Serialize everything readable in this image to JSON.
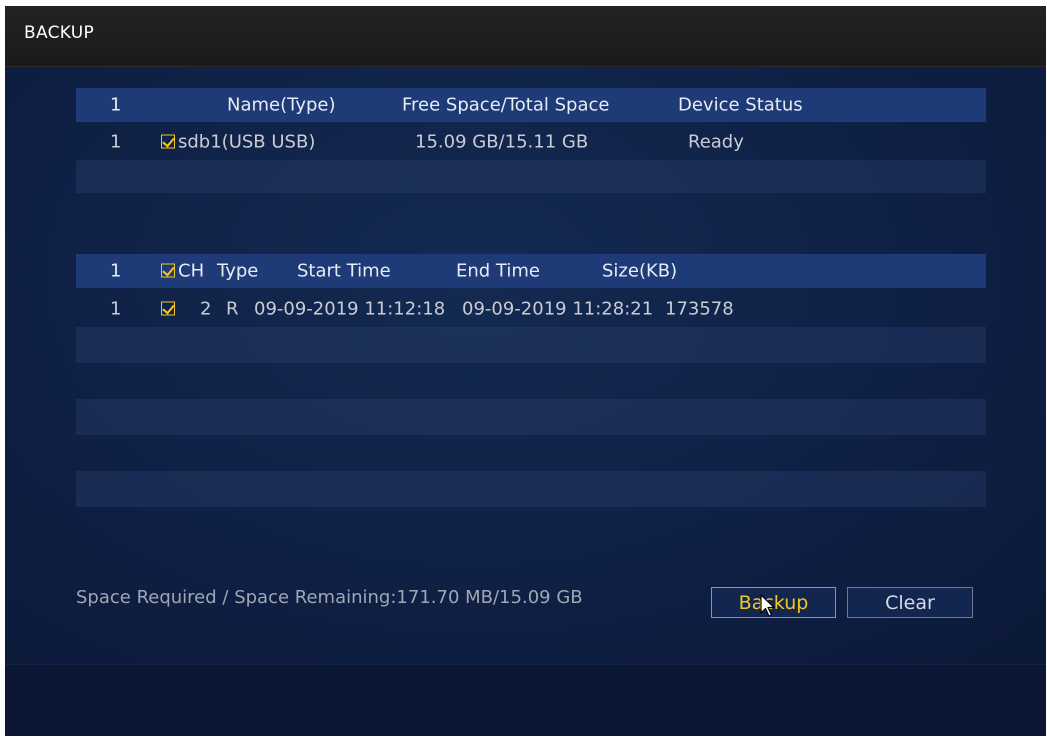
{
  "window": {
    "title": "BACKUP"
  },
  "device_table": {
    "headers": {
      "index": "1",
      "name": "Name(Type)",
      "space": "Free Space/Total Space",
      "status": "Device Status"
    },
    "rows": [
      {
        "index": "1",
        "checked": true,
        "name": "sdb1(USB USB)",
        "space": "15.09 GB/15.11 GB",
        "status": "Ready"
      }
    ]
  },
  "file_table": {
    "headers": {
      "index": "1",
      "ch": "CH",
      "type": "Type",
      "start": "Start Time",
      "end": "End Time",
      "size": "Size(KB)"
    },
    "rows": [
      {
        "index": "1",
        "checked": true,
        "ch": "2",
        "type": "R",
        "start": "09-09-2019 11:12:18",
        "end": "09-09-2019 11:28:21",
        "size": "173578"
      }
    ]
  },
  "footer": {
    "space_info": "Space Required / Space Remaining:171.70 MB/15.09 GB",
    "backup_label": "Backup",
    "clear_label": "Clear"
  },
  "colors": {
    "accent": "#f2c81f",
    "header_bg": "#1e3a77",
    "panel_bg": "#0f2045"
  }
}
